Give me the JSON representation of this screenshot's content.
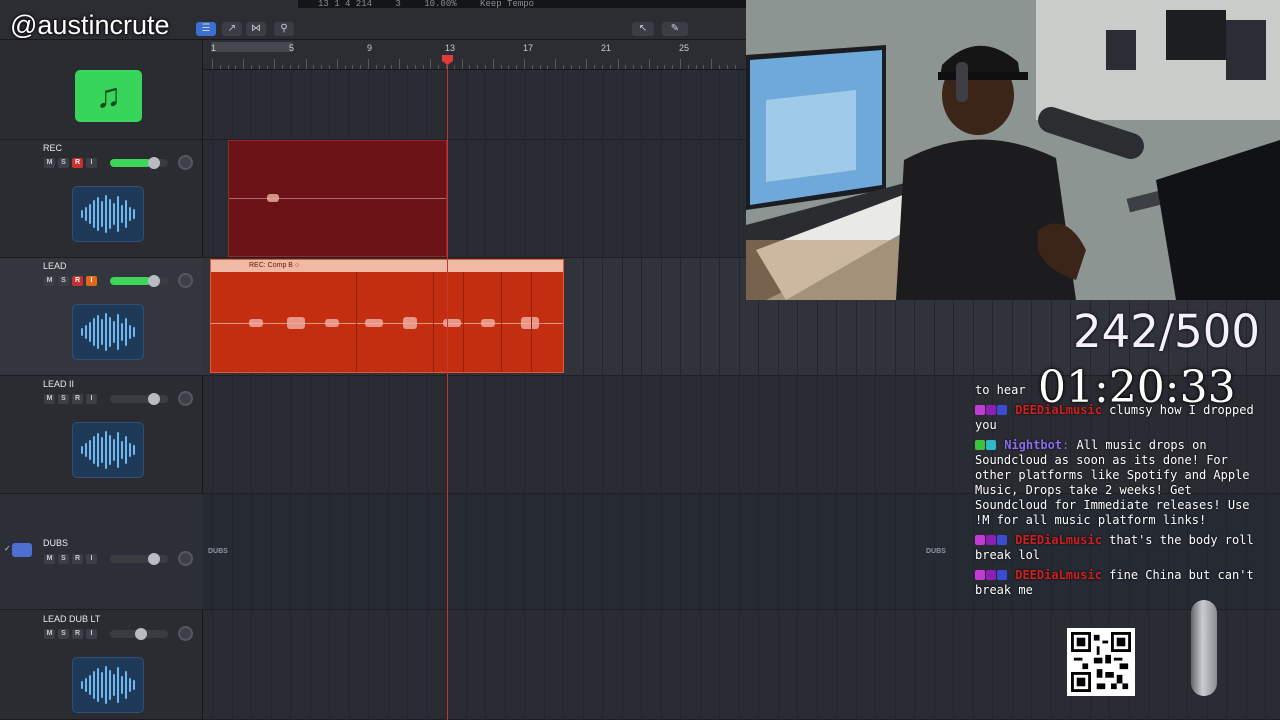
{
  "watermark": "@austincrute",
  "lcd": {
    "position": "13 1 4 214",
    "extra": "3",
    "zoom": "10.00%",
    "mode": "Keep Tempo"
  },
  "ruler": {
    "bars": [
      "1",
      "5",
      "9",
      "13",
      "17",
      "21",
      "25"
    ]
  },
  "tracks": [
    {
      "name": "",
      "type": "software-instrument"
    },
    {
      "name": "REC",
      "buttons": [
        "M",
        "S",
        "R",
        "I"
      ],
      "record_armed": true,
      "input_on": false,
      "volume": 0.72
    },
    {
      "name": "LEAD",
      "buttons": [
        "M",
        "S",
        "R",
        "I"
      ],
      "record_armed": true,
      "input_on": true,
      "volume": 0.72
    },
    {
      "name": "LEAD II",
      "buttons": [
        "M",
        "S",
        "R",
        "I"
      ],
      "record_armed": false,
      "input_on": false,
      "volume": 0.72
    },
    {
      "name": "DUBS",
      "buttons": [
        "M",
        "S",
        "R",
        "I"
      ],
      "record_armed": false,
      "input_on": false,
      "volume": 0.72
    },
    {
      "name": "LEAD DUB LT",
      "buttons": [
        "M",
        "S",
        "R",
        "I"
      ],
      "record_armed": false,
      "input_on": false,
      "volume": 0.5
    }
  ],
  "regions": {
    "lead_header": "REC: Comp B",
    "dubs_label_left": "DUBS",
    "dubs_label_right": "DUBS"
  },
  "overlay": {
    "counter": "242/500",
    "timer": "01:20:33"
  },
  "chat": [
    {
      "user": "",
      "text": "to hear",
      "color": "#ffffff"
    },
    {
      "user": "DEEDiaLmusic",
      "text": "clumsy how I dropped you",
      "color": "#d01f1f"
    },
    {
      "user": "Nightbot",
      "text": "All music drops on Soundcloud as soon as its done! For other platforms like Spotify and Apple Music, Drops take 2 weeks! Get Soundcloud for Immediate releases! Use !M for all music platform links!",
      "color": "#8a6df0"
    },
    {
      "user": "DEEDiaLmusic",
      "text": "that's the body roll break lol",
      "color": "#d01f1f"
    },
    {
      "user": "DEEDiaLmusic",
      "text": "fine China but can't break me",
      "color": "#d01f1f"
    }
  ],
  "colors": {
    "record": "#c43131",
    "input": "#e06a19",
    "volume_fill": "#3dd65b",
    "rec_region": "#6b1317",
    "lead_region": "#c32d10",
    "playhead": "#c83434"
  }
}
